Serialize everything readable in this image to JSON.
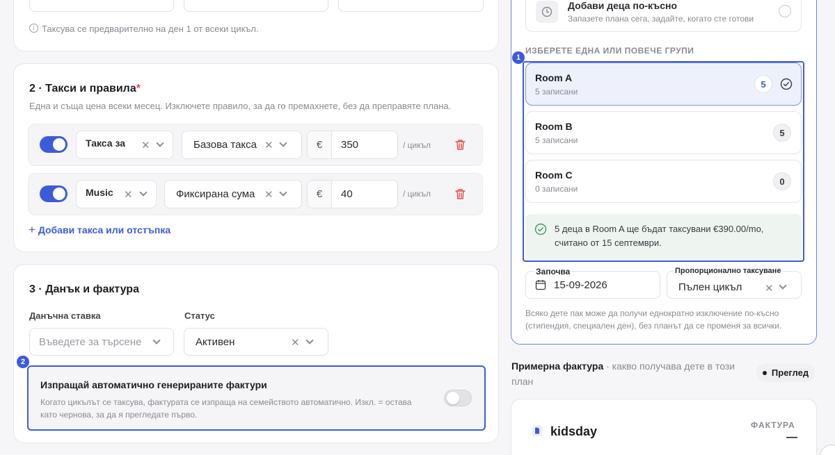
{
  "top": {
    "tax_note": "Таксува се предварително на ден 1 от всеки цикъл."
  },
  "section2": {
    "title": "2 · Такси и правила",
    "required": "*",
    "subtitle": "Една и съща цена всеки месец. Изключете правило, за да го премахнете, без да препра­вяте плана.",
    "rows": [
      {
        "category": "Такса за",
        "type": "Базова такса",
        "currency": "€",
        "amount": "350",
        "per": "/ цикъл"
      },
      {
        "category": "Music",
        "type": "Фиксирана сума",
        "currency": "€",
        "amount": "40",
        "per": "/ цикъл"
      }
    ],
    "add_link": "Добави такса или отстъпка"
  },
  "section3": {
    "title": "3 · Данък и фактура",
    "tax_label": "Данъчна ставка",
    "tax_placeholder": "Въведете за търсене",
    "status_label": "Статус",
    "status_value": "Активен",
    "auto_title": "Изпращай автоматично генерираните фактури",
    "auto_desc": "Когато цикълът се таксува, фактурата се изпраща на семейството автоматично. Изкл. = остава като чернова, за да я прегледате първо.",
    "marker": "2"
  },
  "right": {
    "add_later_title": "Добави деца по-късно",
    "add_later_sub": "Запазете плана сега, задайте, когато сте готови",
    "groups_label": "ИЗБЕРЕТЕ ЕДНА ИЛИ ПОВЕЧЕ ГРУПИ",
    "marker": "1",
    "rooms": [
      {
        "name": "Room A",
        "sub": "5 записани",
        "count": "5"
      },
      {
        "name": "Room B",
        "sub": "5 записани",
        "count": "5"
      },
      {
        "name": "Room C",
        "sub": "0 записани",
        "count": "0"
      }
    ],
    "summary": "5 деца в Room A ще бъдат таксувани €390.00/mo, считано от 15 септември.",
    "start_label": "Започва",
    "start_value": "15-09-2026",
    "prorate_label": "Пропорционално таксуване",
    "prorate_value": "Пълен цикъл",
    "note": "Всяко дете пак може да получи еднократно изключение по-късно (стипендия, специален ден), без планът да се променя за всички.",
    "invoice_title": "Примерна фактура",
    "invoice_sub": " · какво получава дете в този план",
    "preview_btn": "Преглед",
    "brand": "kidsday",
    "invoice_label": "ФАКТУРА",
    "invoice_dash": "—"
  },
  "colors": {
    "accent": "#3d5bd9",
    "success_bg": "#eef5f0",
    "success": "#3f9a63",
    "danger": "#e5484d"
  }
}
